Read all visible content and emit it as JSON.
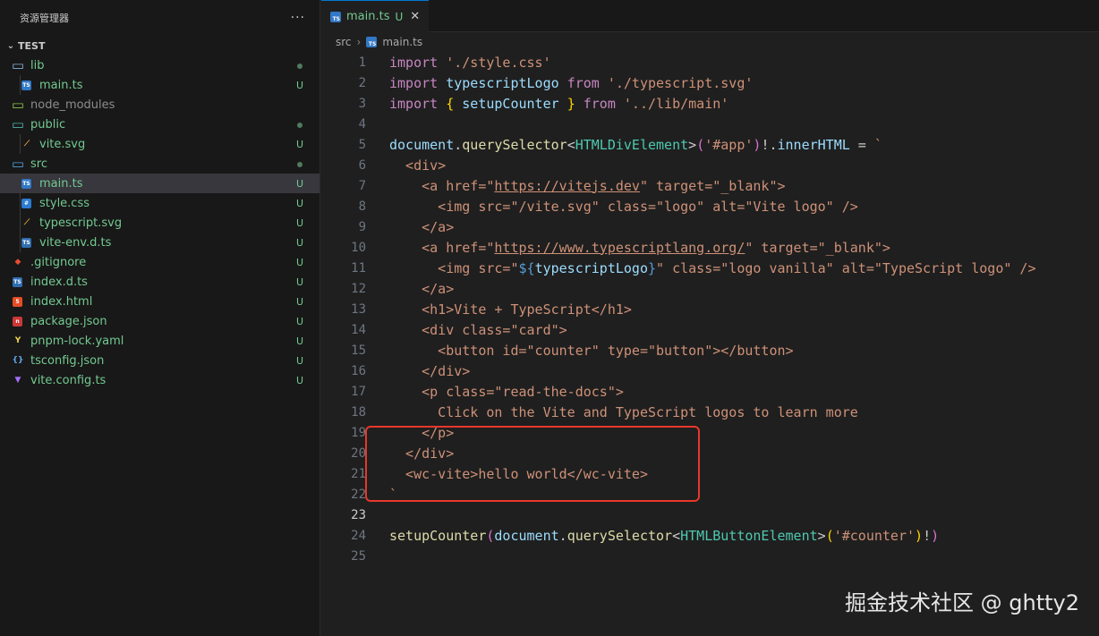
{
  "sidebar": {
    "title": "资源管理器",
    "more": "···",
    "section": "TEST",
    "items": [
      {
        "label": "lib",
        "icon": "folder-icon",
        "indent": 0,
        "status": "dot",
        "color": "#73c991"
      },
      {
        "label": "main.ts",
        "icon": "ts-file-icon",
        "indent": 1,
        "status": "U",
        "color": "#73c991"
      },
      {
        "label": "node_modules",
        "icon": "folder-node-icon",
        "indent": 0,
        "status": "",
        "color": "#8c8c8c"
      },
      {
        "label": "public",
        "icon": "folder-public-icon",
        "indent": 0,
        "status": "dot",
        "color": "#73c991"
      },
      {
        "label": "vite.svg",
        "icon": "svg-file-icon",
        "indent": 1,
        "status": "U",
        "color": "#73c991"
      },
      {
        "label": "src",
        "icon": "folder-src-icon",
        "indent": 0,
        "status": "dot",
        "color": "#73c991"
      },
      {
        "label": "main.ts",
        "icon": "ts-file-icon",
        "indent": 1,
        "status": "U",
        "color": "#73c991",
        "active": true
      },
      {
        "label": "style.css",
        "icon": "css-file-icon",
        "indent": 1,
        "status": "U",
        "color": "#73c991"
      },
      {
        "label": "typescript.svg",
        "icon": "svg-file-icon",
        "indent": 1,
        "status": "U",
        "color": "#73c991"
      },
      {
        "label": "vite-env.d.ts",
        "icon": "dts-file-icon",
        "indent": 1,
        "status": "U",
        "color": "#73c991"
      },
      {
        "label": ".gitignore",
        "icon": "git-icon",
        "indent": 0,
        "status": "U",
        "color": "#73c991"
      },
      {
        "label": "index.d.ts",
        "icon": "dts-file-icon",
        "indent": 0,
        "status": "U",
        "color": "#73c991"
      },
      {
        "label": "index.html",
        "icon": "html-file-icon",
        "indent": 0,
        "status": "U",
        "color": "#73c991"
      },
      {
        "label": "package.json",
        "icon": "npm-icon",
        "indent": 0,
        "status": "U",
        "color": "#73c991"
      },
      {
        "label": "pnpm-lock.yaml",
        "icon": "yaml-icon",
        "indent": 0,
        "status": "U",
        "color": "#73c991"
      },
      {
        "label": "tsconfig.json",
        "icon": "json-icon",
        "indent": 0,
        "status": "U",
        "color": "#73c991"
      },
      {
        "label": "vite.config.ts",
        "icon": "vite-icon",
        "indent": 0,
        "status": "U",
        "color": "#73c991"
      }
    ]
  },
  "tab": {
    "label": "main.ts",
    "status": "U",
    "close": "✕"
  },
  "breadcrumb": {
    "folder": "src",
    "sep": "›",
    "file": "main.ts"
  },
  "code": {
    "current_line": 23,
    "lines": [
      [
        [
          "kw",
          "import"
        ],
        [
          "punc",
          " "
        ],
        [
          "str",
          "'./style.css'"
        ]
      ],
      [
        [
          "kw",
          "import"
        ],
        [
          "punc",
          " "
        ],
        [
          "var",
          "typescriptLogo"
        ],
        [
          "punc",
          " "
        ],
        [
          "kw",
          "from"
        ],
        [
          "punc",
          " "
        ],
        [
          "str",
          "'./typescript.svg'"
        ]
      ],
      [
        [
          "kw",
          "import"
        ],
        [
          "punc",
          " "
        ],
        [
          "brace",
          "{"
        ],
        [
          "punc",
          " "
        ],
        [
          "var",
          "setupCounter"
        ],
        [
          "punc",
          " "
        ],
        [
          "brace",
          "}"
        ],
        [
          "punc",
          " "
        ],
        [
          "kw",
          "from"
        ],
        [
          "punc",
          " "
        ],
        [
          "str",
          "'../lib/main'"
        ]
      ],
      [],
      [
        [
          "var",
          "document"
        ],
        [
          "punc",
          "."
        ],
        [
          "fn",
          "querySelector"
        ],
        [
          "punc",
          "<"
        ],
        [
          "typ",
          "HTMLDivElement"
        ],
        [
          "punc",
          ">"
        ],
        [
          "paren",
          "("
        ],
        [
          "str",
          "'#app'"
        ],
        [
          "paren",
          ")"
        ],
        [
          "punc",
          "!."
        ],
        [
          "var",
          "innerHTML"
        ],
        [
          "punc",
          " = "
        ],
        [
          "tmpl",
          "`"
        ]
      ],
      [
        [
          "tmpl",
          "  <div>"
        ]
      ],
      [
        [
          "tmpl",
          "    <a href=\""
        ],
        [
          "url",
          "https://vitejs.dev"
        ],
        [
          "tmpl",
          "\" target=\"_blank\">"
        ]
      ],
      [
        [
          "tmpl",
          "      <img src=\"/vite.svg\" class=\"logo\" alt=\"Vite logo\" />"
        ]
      ],
      [
        [
          "tmpl",
          "    </a>"
        ]
      ],
      [
        [
          "tmpl",
          "    <a href=\""
        ],
        [
          "url",
          "https://www.typescriptlang.org/"
        ],
        [
          "tmpl",
          "\" target=\"_blank\">"
        ]
      ],
      [
        [
          "tmpl",
          "      <img src=\""
        ],
        [
          "interp",
          "${"
        ],
        [
          "var",
          "typescriptLogo"
        ],
        [
          "interp",
          "}"
        ],
        [
          "tmpl",
          "\" class=\"logo vanilla\" alt=\"TypeScript logo\" />"
        ]
      ],
      [
        [
          "tmpl",
          "    </a>"
        ]
      ],
      [
        [
          "tmpl",
          "    <h1>Vite + TypeScript</h1>"
        ]
      ],
      [
        [
          "tmpl",
          "    <div class=\"card\">"
        ]
      ],
      [
        [
          "tmpl",
          "      <button id=\"counter\" type=\"button\"></button>"
        ]
      ],
      [
        [
          "tmpl",
          "    </div>"
        ]
      ],
      [
        [
          "tmpl",
          "    <p class=\"read-the-docs\">"
        ]
      ],
      [
        [
          "tmpl",
          "      Click on the Vite and TypeScript logos to learn more"
        ]
      ],
      [
        [
          "tmpl",
          "    </p>"
        ]
      ],
      [
        [
          "tmpl",
          "  </div>"
        ]
      ],
      [
        [
          "tmpl",
          "  <wc-vite>hello world</wc-vite>"
        ]
      ],
      [
        [
          "tmpl",
          "`"
        ]
      ],
      [],
      [
        [
          "fn",
          "setupCounter"
        ],
        [
          "paren",
          "("
        ],
        [
          "var",
          "document"
        ],
        [
          "punc",
          "."
        ],
        [
          "fn",
          "querySelector"
        ],
        [
          "punc",
          "<"
        ],
        [
          "typ",
          "HTMLButtonElement"
        ],
        [
          "punc",
          ">"
        ],
        [
          "brace",
          "("
        ],
        [
          "str",
          "'#counter'"
        ],
        [
          "brace",
          ")"
        ],
        [
          "punc",
          "!"
        ],
        [
          "paren",
          ")"
        ]
      ],
      []
    ]
  },
  "watermark": "掘金技术社区 @ ghtty2"
}
